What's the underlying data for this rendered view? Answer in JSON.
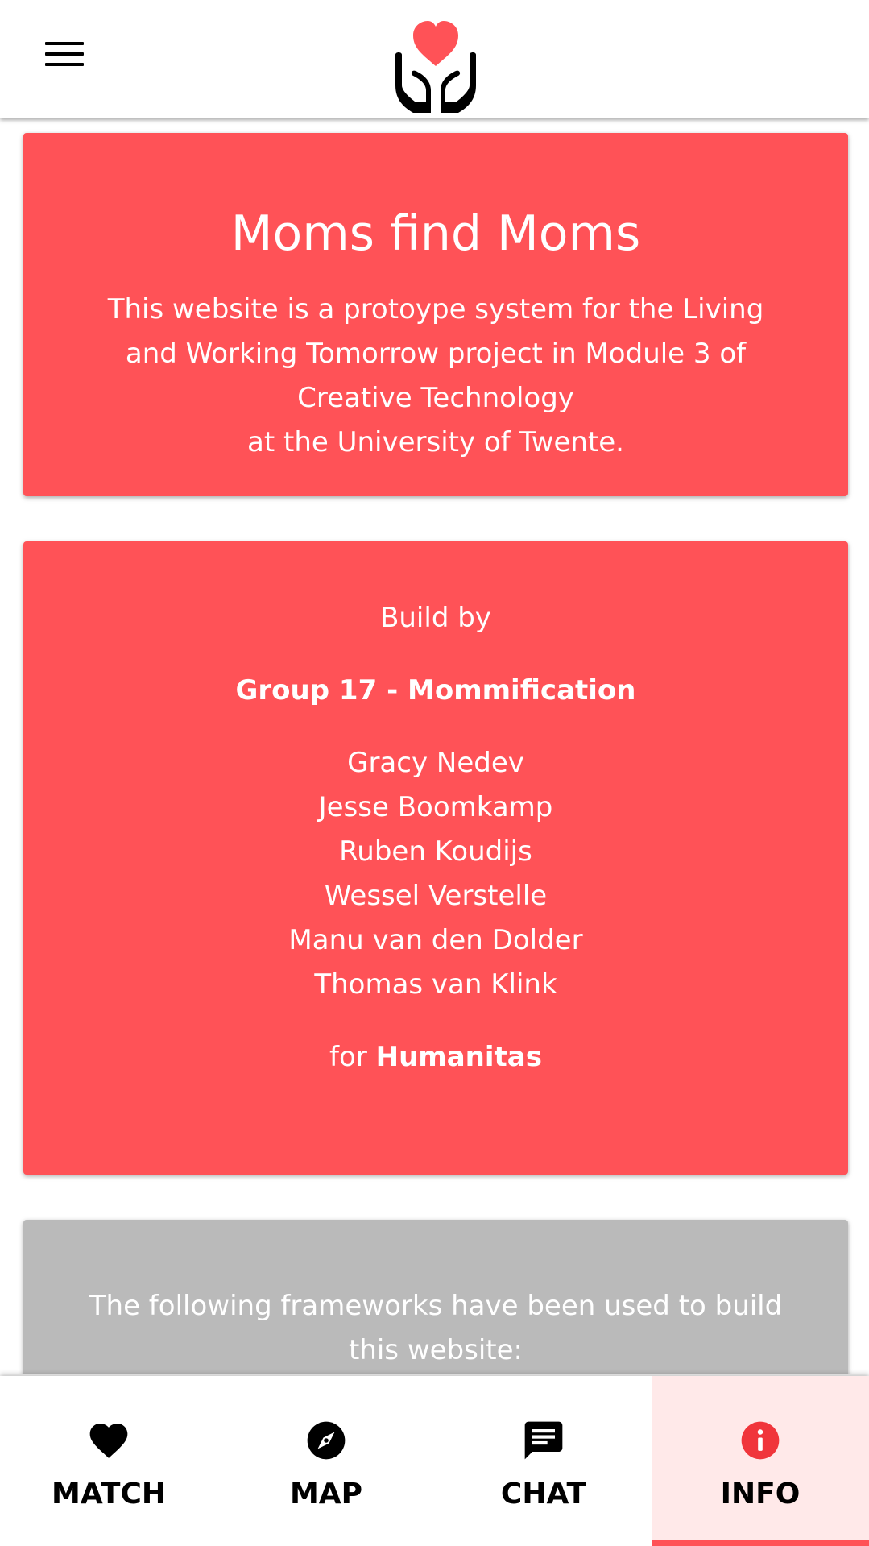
{
  "colors": {
    "accent": "#ff5257",
    "card_red": "#ff5257",
    "card_gray": "#bababa",
    "active_tab_bg": "#ffe9e9"
  },
  "header": {
    "menu_icon": "hamburger-menu-icon",
    "logo_icon": "heart-in-hands-icon"
  },
  "intro": {
    "title": "Moms find Moms",
    "line1": "This website is a protoype system for the Living and Working Tomorrow project in Module 3 of Creative Technology",
    "line2": "at the University of Twente."
  },
  "team": {
    "build_by": "Build by",
    "group": "Group 17 - Mommification",
    "members": [
      "Gracy Nedev",
      "Jesse Boomkamp",
      "Ruben Koudijs",
      "Wessel Verstelle",
      "Manu van den Dolder",
      "Thomas van Klink"
    ],
    "for_prefix": "for",
    "client": "Humanitas"
  },
  "frameworks": {
    "text": "The following frameworks have been used to build this website:"
  },
  "bottom_nav": {
    "items": [
      {
        "label": "MATCH",
        "icon": "heart-icon"
      },
      {
        "label": "MAP",
        "icon": "compass-icon"
      },
      {
        "label": "CHAT",
        "icon": "chat-icon"
      },
      {
        "label": "INFO",
        "icon": "info-icon"
      }
    ],
    "active": "INFO"
  }
}
